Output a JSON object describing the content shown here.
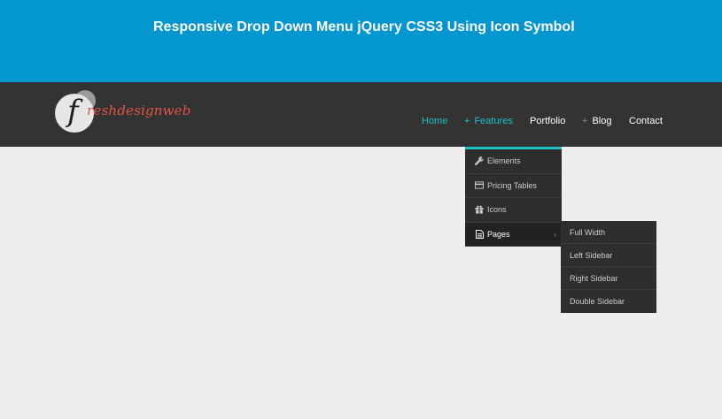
{
  "banner": {
    "title": "Responsive Drop Down Menu jQuery CSS3 Using Icon Symbol"
  },
  "logo": {
    "initial": "f",
    "text": "reshdesignweb"
  },
  "nav": {
    "home": "Home",
    "features": "Features",
    "portfolio": "Portfolio",
    "blog": "Blog",
    "contact": "Contact",
    "plus": "+"
  },
  "dropdown": {
    "items": [
      {
        "label": "Elements",
        "icon": "wrench-icon"
      },
      {
        "label": "Pricing Tables",
        "icon": "credit-card-icon"
      },
      {
        "label": "Icons",
        "icon": "gift-icon"
      },
      {
        "label": "Pages",
        "icon": "document-icon"
      }
    ],
    "arrow": "›"
  },
  "submenu": {
    "items": [
      "Full Width",
      "Left Sidebar",
      "Right Sidebar",
      "Double Sidebar"
    ]
  },
  "colors": {
    "banner": "#0396cf",
    "navbar": "#333333",
    "accent": "#1fc0c8",
    "logo_text": "#e2534a"
  }
}
